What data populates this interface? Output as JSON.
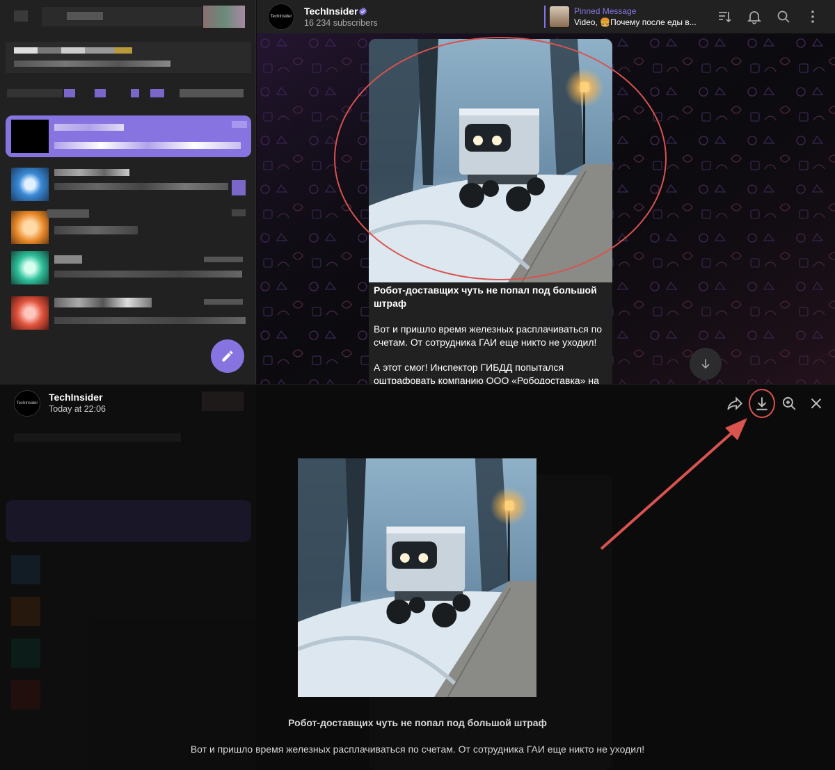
{
  "channel": {
    "name": "TechInsider",
    "avatar_text": "TechInsider",
    "subscribers": "16 234 subscribers"
  },
  "pinned": {
    "title": "Pinned Message",
    "text": "Video, 🍔Почему после еды в..."
  },
  "message": {
    "title": "Робот-доставщих чуть не попал под большой штраф",
    "paragraph1": "Вот и пришло время железных расплачиваться по счетам. От сотрудника ГАИ еще никто не уходил!",
    "paragraph2": "А этот смог! Инспектор ГИБДД попытался оштрафовать компанию ООО «Рободоставка» на"
  },
  "viewer": {
    "author": "TechInsider",
    "time": "Today at 22:06",
    "caption_title": "Робот-доставщих чуть не попал под большой штраф",
    "caption_text": "Вот и пришло время железных расплачиваться по счетам. От сотрудника ГАИ еще никто не уходил!"
  },
  "icons": {
    "header": [
      "sort-icon",
      "bell-icon",
      "search-icon",
      "more-vertical-icon"
    ],
    "viewer": [
      "forward-icon",
      "download-icon",
      "zoom-in-icon",
      "close-icon"
    ],
    "fab": "pencil-icon",
    "scroll": "arrow-down-icon"
  },
  "colors": {
    "accent": "#8774e1",
    "annotation": "#d9534f",
    "sidebar_bg": "#212121",
    "chat_bg": "#0f0f0f"
  }
}
